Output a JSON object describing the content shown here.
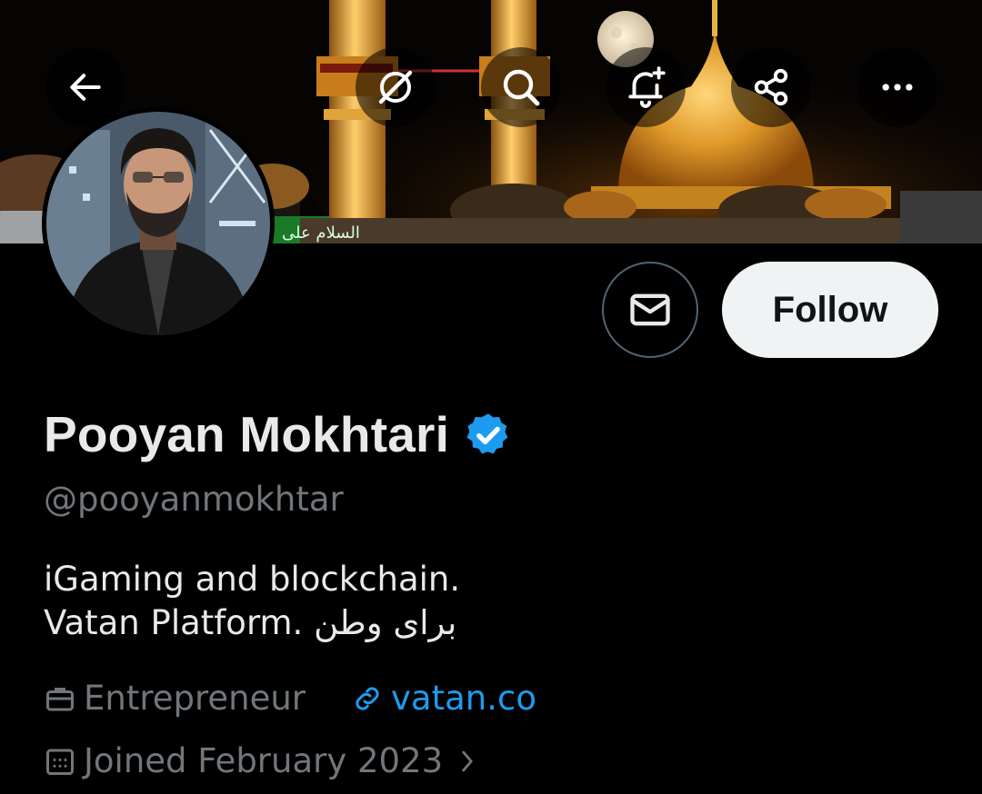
{
  "profile": {
    "display_name": "Pooyan Mokhtari",
    "handle": "@pooyanmokhtar",
    "verified": true,
    "bio_line1": "iGaming and blockchain.",
    "bio_line2": "Vatan Platform. برای وطن",
    "category": "Entrepreneur",
    "website": "vatan.co",
    "joined": "Joined February 2023"
  },
  "actions": {
    "follow_label": "Follow"
  },
  "banner": {
    "sign_text": "السلام علی"
  },
  "icons": {
    "back": "back-arrow-icon",
    "grok": "grok-icon",
    "search": "search-icon",
    "notify": "bell-plus-icon",
    "share": "share-icon",
    "more": "more-dots-icon",
    "message": "envelope-icon",
    "verified": "verified-badge-icon",
    "category": "briefcase-icon",
    "link": "link-icon",
    "calendar": "calendar-icon",
    "chevron": "chevron-right-icon"
  },
  "colors": {
    "background": "#000000",
    "primary_text": "#e7e9ea",
    "secondary_text": "#71767b",
    "link": "#1d9bf0",
    "verified": "#1d9bf0",
    "follow_bg": "#eff3f4"
  }
}
